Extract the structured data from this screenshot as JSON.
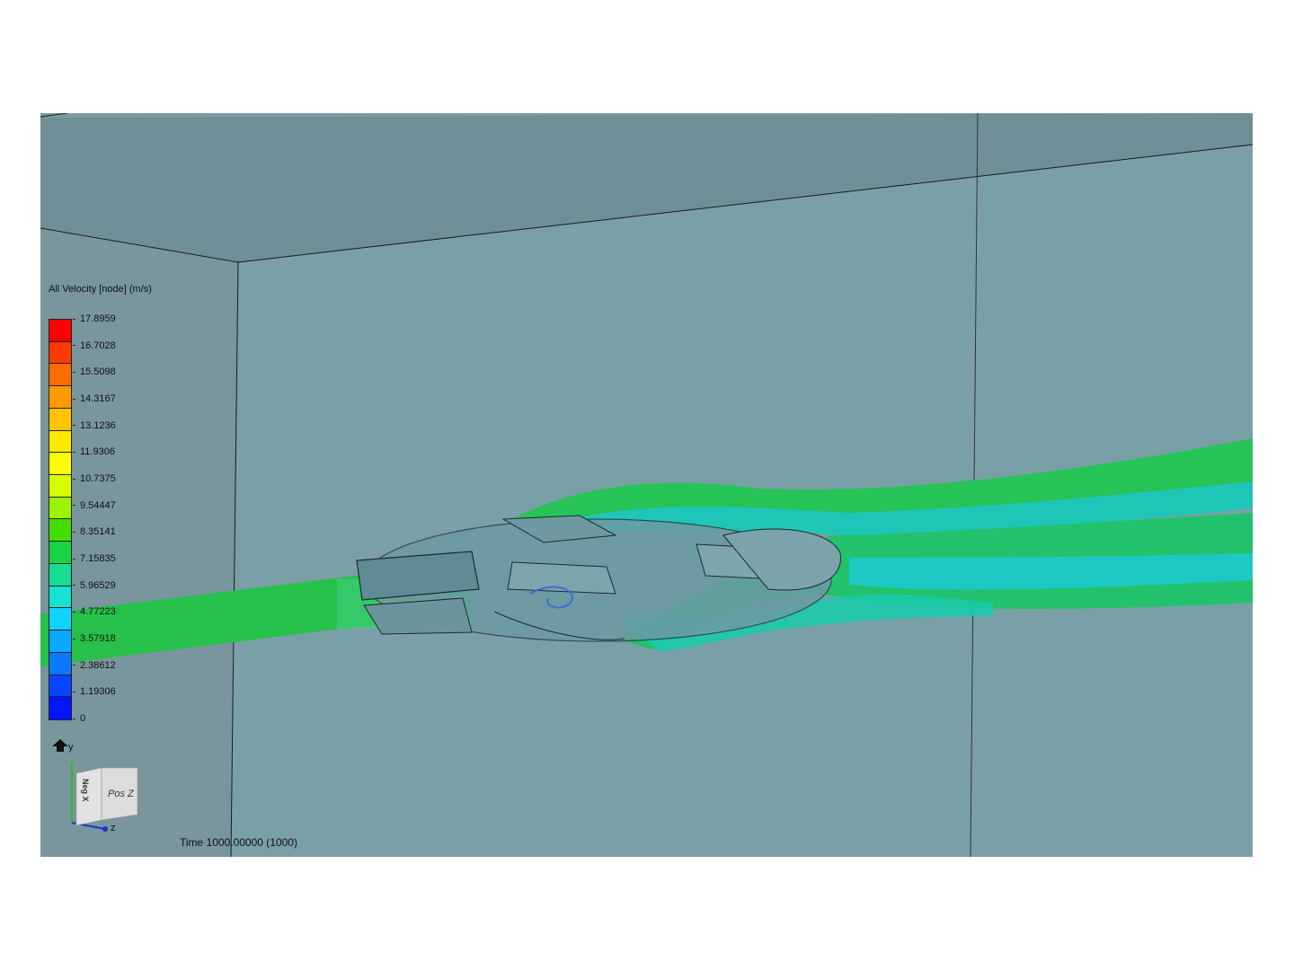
{
  "legend": {
    "title": "All Velocity [node] (m/s)",
    "ticks": [
      "17.8959",
      "16.7028",
      "15.5098",
      "14.3167",
      "13.1236",
      "11.9306",
      "10.7375",
      "9.54447",
      "8.35141",
      "7.15835",
      "5.96529",
      "4.77223",
      "3.57918",
      "2.38612",
      "1.19306",
      "0"
    ],
    "colors": [
      "#ff0000",
      "#ff3a00",
      "#ff6b00",
      "#ff9a00",
      "#ffc400",
      "#ffe800",
      "#ffff00",
      "#d8ff00",
      "#9cf500",
      "#45dd00",
      "#16d444",
      "#17dc93",
      "#14e2d2",
      "#12d2ff",
      "#0aa8ff",
      "#0a78ff",
      "#0646ff",
      "#0016ff"
    ]
  },
  "triad": {
    "y_label": "y",
    "z_label": "z",
    "x_label": "X",
    "front_face": "Pos Z",
    "side_face": "Neg X"
  },
  "status": {
    "time_label": "Time 1000.00000 (1000)"
  },
  "colors": {
    "background": "#7a9da5",
    "ceiling": "#6e8f95",
    "streamline_green": "#1fc23f",
    "streamline_cyan": "#19c9c9"
  }
}
